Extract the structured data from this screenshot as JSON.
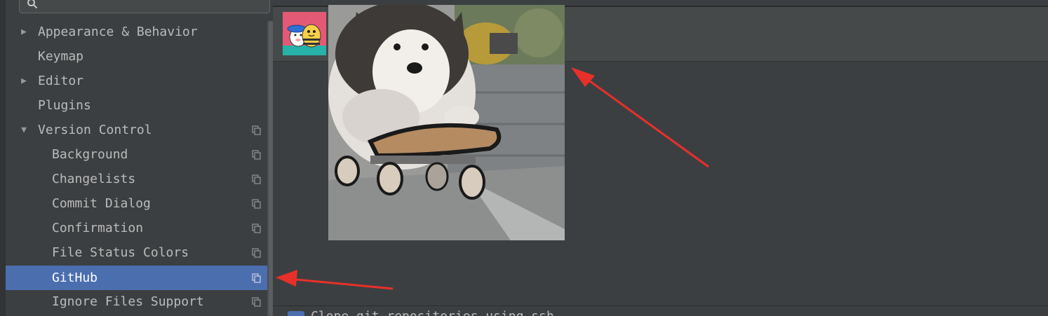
{
  "search": {
    "placeholder": ""
  },
  "tree": {
    "items": [
      {
        "label": "Appearance & Behavior",
        "arrow": "▶"
      },
      {
        "label": "Keymap",
        "arrow": ""
      },
      {
        "label": "Editor",
        "arrow": "▶"
      },
      {
        "label": "Plugins",
        "arrow": ""
      },
      {
        "label": "Version Control",
        "arrow": "▼"
      },
      {
        "label": "Background"
      },
      {
        "label": "Changelists"
      },
      {
        "label": "Commit Dialog"
      },
      {
        "label": "Confirmation"
      },
      {
        "label": "File Status Colors"
      },
      {
        "label": "GitHub",
        "selected": true
      },
      {
        "label": "Ignore Files Support"
      }
    ]
  },
  "content": {
    "avatar_icon": "cartoon-avatar-icon",
    "image_subject": "dog-on-skateboard",
    "bottom_text": "Clone git repositories using ssh"
  },
  "colors": {
    "selection": "#4b6eaf",
    "background": "#3c3f41",
    "annotation_arrow": "#e8302a"
  }
}
